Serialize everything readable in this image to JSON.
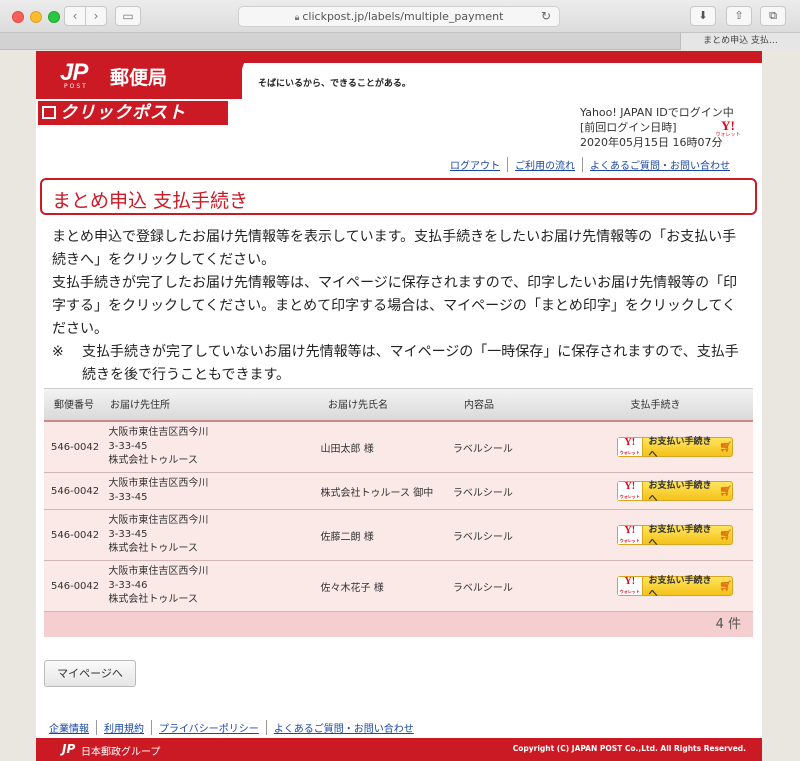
{
  "browser": {
    "url": "clickpost.jp/labels/multiple_payment",
    "tab_title": "まとめ申込 支払…"
  },
  "header": {
    "logo_jp": "JP",
    "logo_post": "POST",
    "logo_office": "郵便局",
    "tagline": "そばにいるから、できることがある。",
    "service_name": "クリックポスト",
    "login_line1": "Yahoo! JAPAN IDでログイン中",
    "login_line2": "[前回ログイン日時]",
    "login_line3": "2020年05月15日 16時07分",
    "wallet_y": "Y!",
    "wallet_label": "ウォレット",
    "links": [
      "ログアウト",
      "ご利用の流れ",
      "よくあるご質問・お問い合わせ"
    ]
  },
  "page_title": "まとめ申込 支払手続き",
  "description": {
    "para1": "まとめ申込で登録したお届け先情報等を表示しています。支払手続きをしたいお届け先情報等の「お支払い手続きへ」をクリックしてください。",
    "para2": "支払手続きが完了したお届け先情報等は、マイページに保存されますので、印字したいお届け先情報等の「印字する」をクリックしてください。まとめて印字する場合は、マイページの「まとめ印字」をクリックしてください。",
    "note_mark": "※",
    "note": "支払手続きが完了していないお届け先情報等は、マイページの「一時保存」に保存されますので、支払手続きを後で行うこともできます。"
  },
  "table": {
    "headers": [
      "郵便番号",
      "お届け先住所",
      "お届け先氏名",
      "内容品",
      "支払手続き"
    ],
    "rows": [
      {
        "zip": "546-0042",
        "addr1": "大阪市東住吉区西今川",
        "addr2": "3-33-45",
        "addr3": "株式会社トゥルース",
        "name": "山田太郎 様",
        "item": "ラベルシール",
        "pay": "お支払い手続きへ"
      },
      {
        "zip": "546-0042",
        "addr1": "大阪市東住吉区西今川",
        "addr2": "3-33-45",
        "addr3": "",
        "name": "株式会社トゥルース 御中",
        "item": "ラベルシール",
        "pay": "お支払い手続きへ"
      },
      {
        "zip": "546-0042",
        "addr1": "大阪市東住吉区西今川",
        "addr2": "3-33-45",
        "addr3": "株式会社トゥルース",
        "name": "佐藤二朗 様",
        "item": "ラベルシール",
        "pay": "お支払い手続きへ"
      },
      {
        "zip": "546-0042",
        "addr1": "大阪市東住吉区西今川",
        "addr2": "3-33-46",
        "addr3": "株式会社トゥルース",
        "name": "佐々木花子 様",
        "item": "ラベルシール",
        "pay": "お支払い手続きへ"
      }
    ],
    "count": "4 件"
  },
  "mypage_button": "マイページへ",
  "footer": {
    "links": [
      "企業情報",
      "利用規約",
      "プライバシーポリシー",
      "よくあるご質問・お問い合わせ"
    ],
    "group_jp": "JP",
    "group_name": "日本郵政グループ",
    "copyright": "Copyright (C) JAPAN POST Co.,Ltd.  All Rights Reserved."
  },
  "colors": {
    "brand_red": "#cc1a25",
    "row_bg": "#fbe9e8",
    "link_blue": "#1a47a6",
    "pay_yellow": "#f4c21a"
  }
}
